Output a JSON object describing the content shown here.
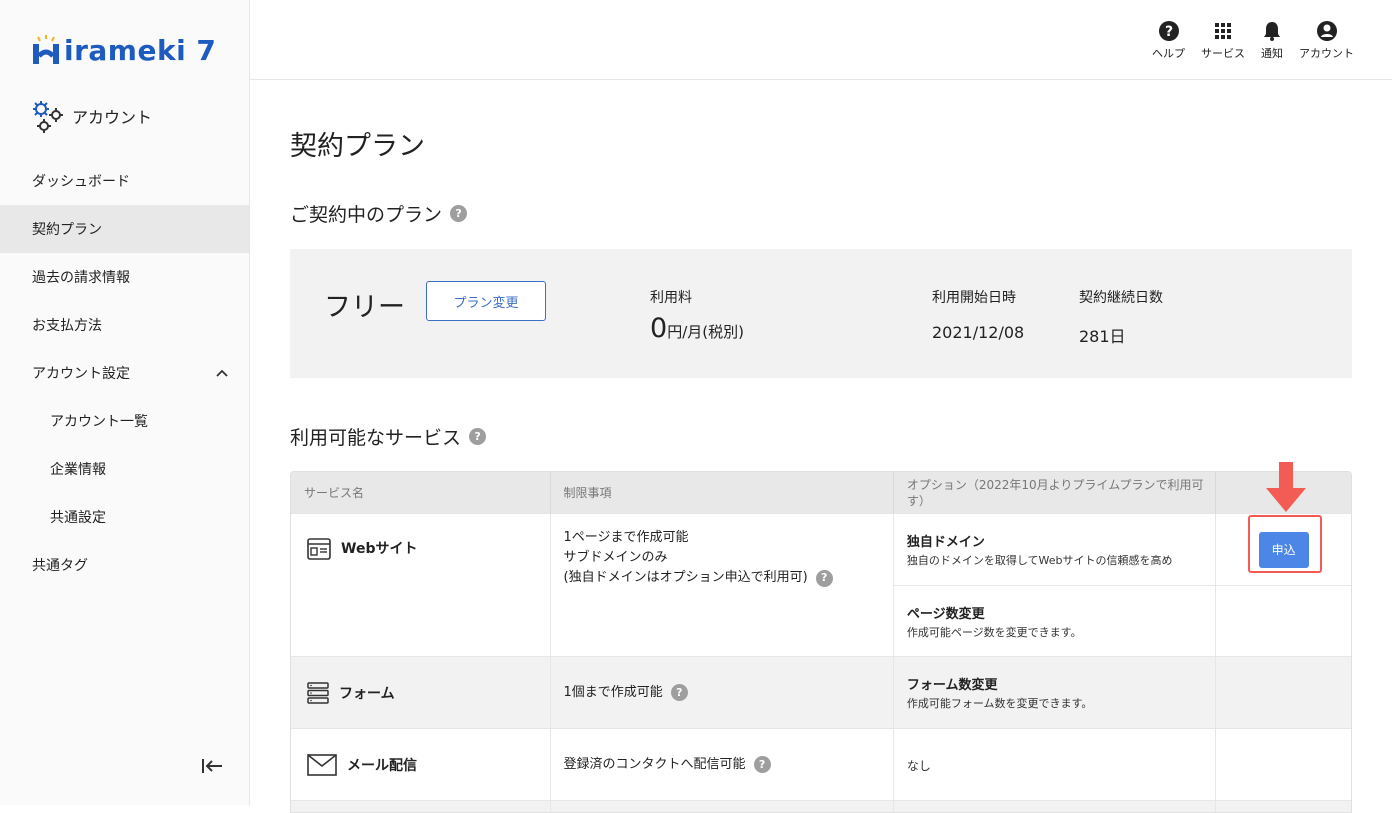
{
  "brand": {
    "logo_text": "irameki 7"
  },
  "sidebar": {
    "section_title": "アカウント",
    "items": [
      {
        "label": "ダッシュボード"
      },
      {
        "label": "契約プラン"
      },
      {
        "label": "過去の請求情報"
      },
      {
        "label": "お支払方法"
      },
      {
        "label": "アカウント設定"
      },
      {
        "label": "アカウント一覧"
      },
      {
        "label": "企業情報"
      },
      {
        "label": "共通設定"
      },
      {
        "label": "共通タグ"
      }
    ]
  },
  "topbar": {
    "help": "ヘルプ",
    "services": "サービス",
    "notifications": "通知",
    "account": "アカウント"
  },
  "page": {
    "title": "契約プラン"
  },
  "current_plan": {
    "section_title": "ご契約中のプラン",
    "plan_name": "フリー",
    "change_button": "プラン変更",
    "fee_label": "利用料",
    "fee_value": "0",
    "fee_unit": "円/月(税別)",
    "start_label": "利用開始日時",
    "start_value": "2021/12/08",
    "days_label": "契約継続日数",
    "days_value": "281日"
  },
  "services": {
    "section_title": "利用可能なサービス",
    "columns": [
      "サービス名",
      "制限事項",
      "オプション（2022年10月よりプライムプランで利用可",
      "す）"
    ],
    "apply_label": "申込",
    "rows": [
      {
        "name": "Webサイト",
        "limit_lines": [
          "1ページまで作成可能",
          "サブドメインのみ",
          "(独自ドメインはオプション申込で利用可)"
        ],
        "options": [
          {
            "title": "独自ドメイン",
            "desc": "独自のドメインを取得してWebサイトの信頼感を高め"
          },
          {
            "title": "ページ数変更",
            "desc": "作成可能ページ数を変更できます。"
          }
        ]
      },
      {
        "name": "フォーム",
        "limit_lines": [
          "1個まで作成可能"
        ],
        "options": [
          {
            "title": "フォーム数変更",
            "desc": "作成可能フォーム数を変更できます。"
          }
        ]
      },
      {
        "name": "メール配信",
        "limit_lines": [
          "登録済のコンタクトへ配信可能"
        ],
        "options_text": "なし"
      }
    ]
  },
  "colors": {
    "accent": "#4c86e6",
    "brand": "#1d5bbf",
    "highlight": "#f25c54"
  }
}
